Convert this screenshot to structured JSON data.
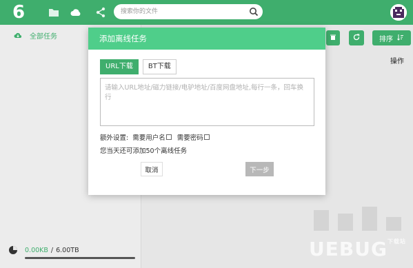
{
  "app": {
    "logo_text": "6"
  },
  "nav": {
    "icons": [
      "folder-icon",
      "cloud-icon",
      "share-icon"
    ]
  },
  "search": {
    "placeholder": "搜索你的文件"
  },
  "sidebar": {
    "items": [
      {
        "label": "全部任务",
        "icon": "cloud-download-icon"
      }
    ],
    "storage": {
      "used": "0.00KB",
      "separator": "/",
      "total": "6.00TB"
    }
  },
  "toolbar": {
    "sort_label": "排序"
  },
  "table": {
    "operations_header": "操作"
  },
  "dialog": {
    "title": "添加离线任务",
    "tabs": [
      {
        "label": "URL下载",
        "active": true
      },
      {
        "label": "BT下载",
        "active": false
      }
    ],
    "url_placeholder": "请输入URL地址/磁力链接/电驴地址/百度网盘地址,每行一条，回车换行",
    "extra_label": "额外设置:",
    "need_username": "需要用户名",
    "need_password": "需要密码",
    "quota_text": "您当天还可添加50个离线任务",
    "cancel_label": "取消",
    "next_label": "下一步"
  },
  "watermark": {
    "text": "UEBUG",
    "small": "下载站"
  },
  "colors": {
    "brand": "#3fae6d",
    "dialog_header": "#4fce8a",
    "disabled": "#b8b8b8"
  }
}
